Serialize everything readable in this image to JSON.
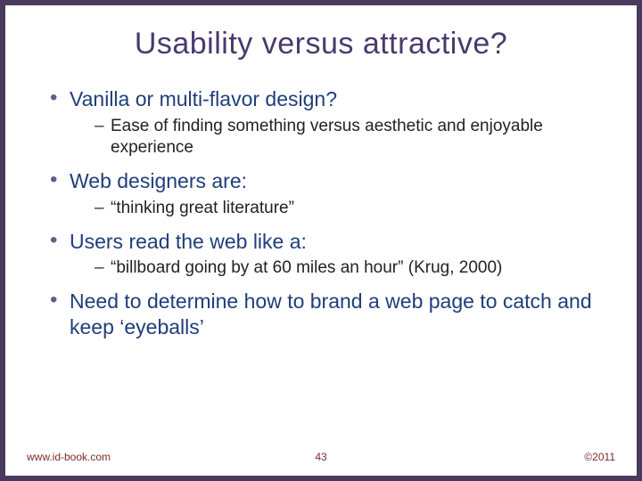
{
  "title": "Usability versus attractive?",
  "bullets": [
    {
      "text": "Vanilla or multi-flavor design?",
      "sub": [
        "Ease of finding something versus aesthetic and enjoyable experience"
      ]
    },
    {
      "text": "Web designers are:",
      "sub": [
        " “thinking great literature”"
      ]
    },
    {
      "text": "Users read the web like a:",
      "sub": [
        "“billboard going by at 60 miles an hour” (Krug, 2000)"
      ]
    },
    {
      "text": "Need to determine how to brand a web page to catch and keep ‘eyeballs’",
      "sub": []
    }
  ],
  "footer": {
    "url": "www.id-book.com",
    "page": "43",
    "copyright": "©2011"
  }
}
